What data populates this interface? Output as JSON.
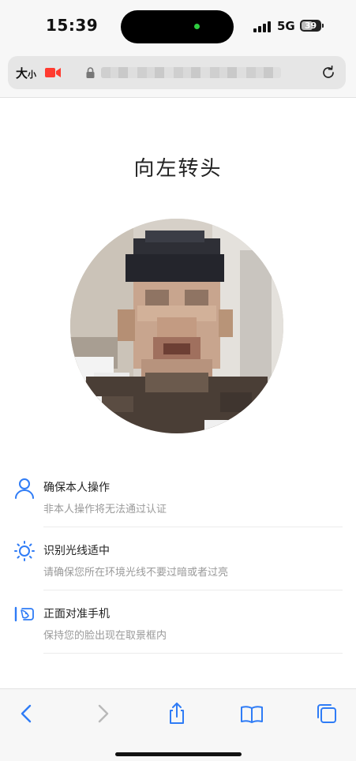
{
  "status_bar": {
    "time": "15:39",
    "network": "5G",
    "battery": "39"
  },
  "address_bar": {
    "text_size_large": "大",
    "text_size_small": "小"
  },
  "page": {
    "title": "向左转头"
  },
  "tips": [
    {
      "icon": "person-icon",
      "title": "确保本人操作",
      "desc": "非本人操作将无法通过认证"
    },
    {
      "icon": "sun-icon",
      "title": "识别光线适中",
      "desc": "请确保您所在环境光线不要过暗或者过亮"
    },
    {
      "icon": "face-frame-icon",
      "title": "正面对准手机",
      "desc": "保持您的脸出现在取景框内"
    }
  ],
  "toolbar": {
    "icons": [
      "back-icon",
      "forward-icon",
      "share-icon",
      "bookmarks-icon",
      "tabs-icon"
    ]
  },
  "colors": {
    "accent": "#2f7cf6",
    "record": "#ff3b30"
  }
}
